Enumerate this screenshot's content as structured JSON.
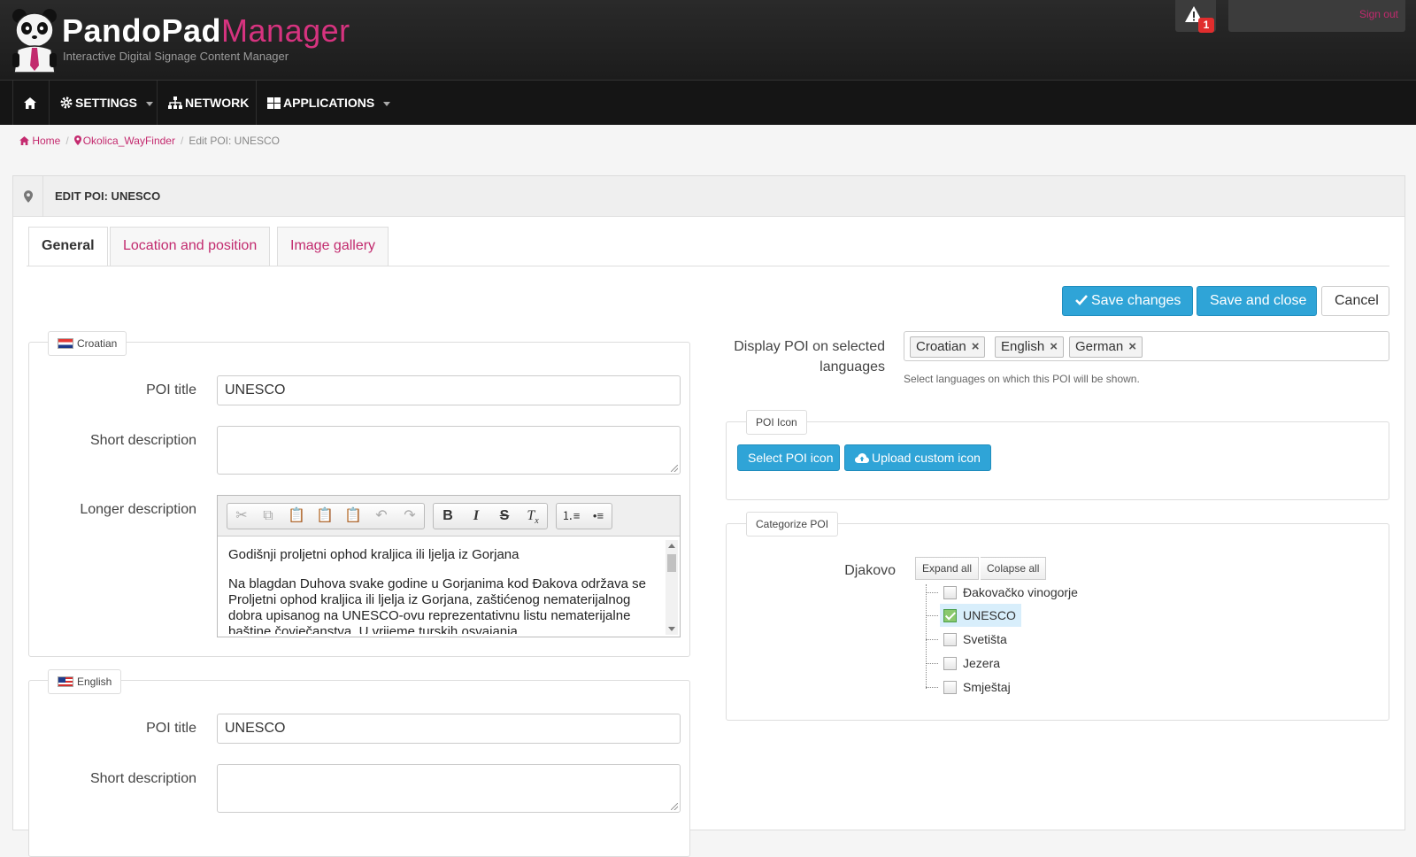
{
  "header": {
    "brand_primary": "PandoPad",
    "brand_secondary": "Manager",
    "tagline": "Interactive Digital Signage Content Manager",
    "alert_count": "1",
    "signout_label": "Sign out"
  },
  "nav": {
    "items": [
      {
        "label": ""
      },
      {
        "label": "SETTINGS"
      },
      {
        "label": "NETWORK"
      },
      {
        "label": "APPLICATIONS"
      }
    ]
  },
  "breadcrumb": {
    "home": "Home",
    "parent": "Okolica_WayFinder",
    "current": "Edit POI: UNESCO"
  },
  "panel": {
    "title": "EDIT POI: UNESCO",
    "tabs": [
      {
        "label": "General"
      },
      {
        "label": "Location and position"
      },
      {
        "label": "Image gallery"
      }
    ],
    "actions": {
      "save_changes": "Save changes",
      "save_and_close": "Save and close",
      "cancel": "Cancel"
    }
  },
  "croatian": {
    "legend": "Croatian",
    "poi_title_label": "POI title",
    "poi_title_value": "UNESCO",
    "short_desc_label": "Short description",
    "long_desc_label": "Longer description",
    "long_desc_p1": "Godišnji proljetni ophod kraljica ili ljelja iz Gorjana",
    "long_desc_p2": "Na blagdan Duhova svake godine u Gorjanima kod Đakova održava se Proljetni ophod kraljica ili ljelja iz Gorjana, zaštićenog nematerijalnog dobra upisanog na UNESCO-ovu reprezentativnu listu nematerijalne baštine čovječanstva. U vrijeme turskih osvajanja"
  },
  "english": {
    "legend": "English",
    "poi_title_label": "POI title",
    "poi_title_value": "UNESCO",
    "short_desc_label": "Short description"
  },
  "languages": {
    "label": "Display POI on selected languages",
    "tags": [
      "Croatian",
      "English",
      "German"
    ],
    "help": "Select languages on which this POI will be shown."
  },
  "poi_icon": {
    "legend": "POI Icon",
    "select_label": "Select POI icon",
    "upload_label": "Upload custom icon"
  },
  "categorize": {
    "legend": "Categorize POI",
    "group_label": "Djakovo",
    "expand_all": "Expand all",
    "collapse_all": "Colapse all",
    "items": [
      {
        "label": "Đakovačko vinogorje",
        "checked": false
      },
      {
        "label": "UNESCO",
        "checked": true
      },
      {
        "label": "Svetišta",
        "checked": false
      },
      {
        "label": "Jezera",
        "checked": false
      },
      {
        "label": "Smještaj",
        "checked": false
      }
    ]
  },
  "colors": {
    "accent": "#c22a6e",
    "primary_button": "#2fa4d7",
    "header_bg": "#1c1c1c"
  }
}
